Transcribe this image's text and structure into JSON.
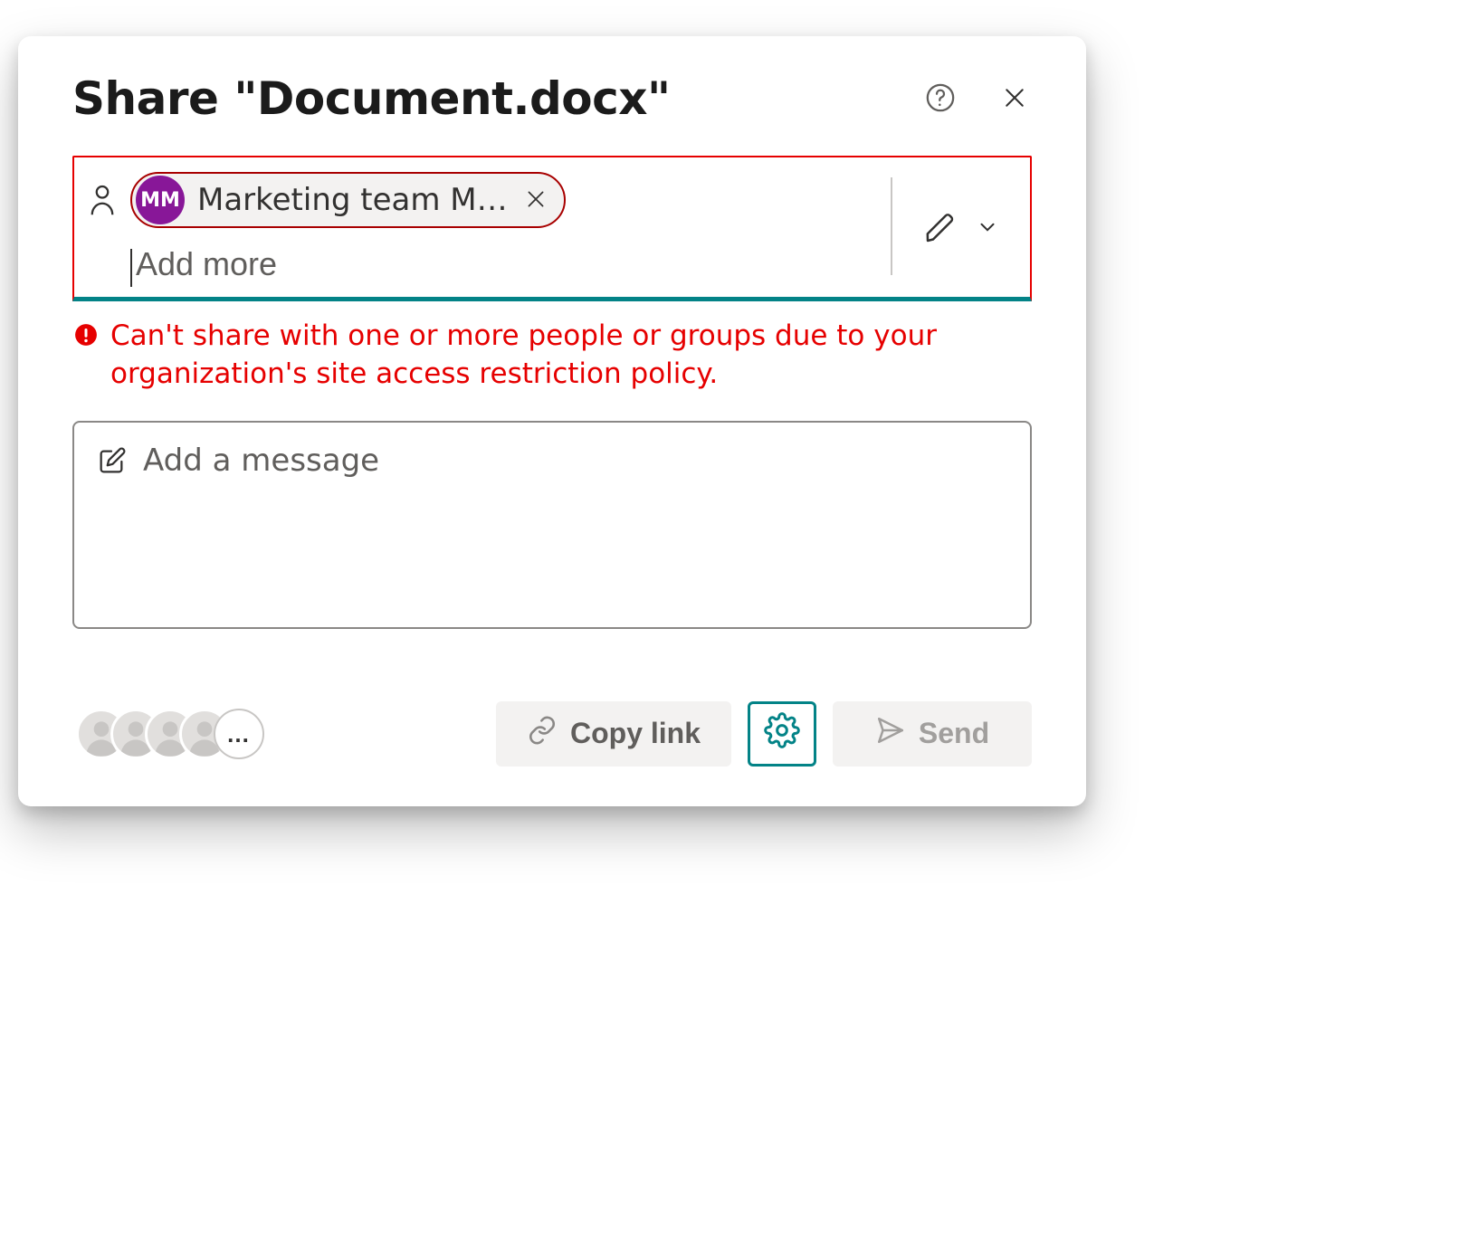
{
  "header": {
    "title": "Share \"Document.docx\""
  },
  "recipient": {
    "chip": {
      "initials": "MM",
      "label": "Marketing team M…"
    },
    "placeholder": "Add more"
  },
  "error": {
    "message": "Can't share with one or more people or groups due to your organization's site access restriction policy."
  },
  "message": {
    "placeholder": "Add a message"
  },
  "footer": {
    "copy_label": "Copy link",
    "send_label": "Send",
    "overflow_label": "…"
  },
  "colors": {
    "error": "#e60000",
    "accent": "#038387",
    "avatar": "#881798"
  }
}
